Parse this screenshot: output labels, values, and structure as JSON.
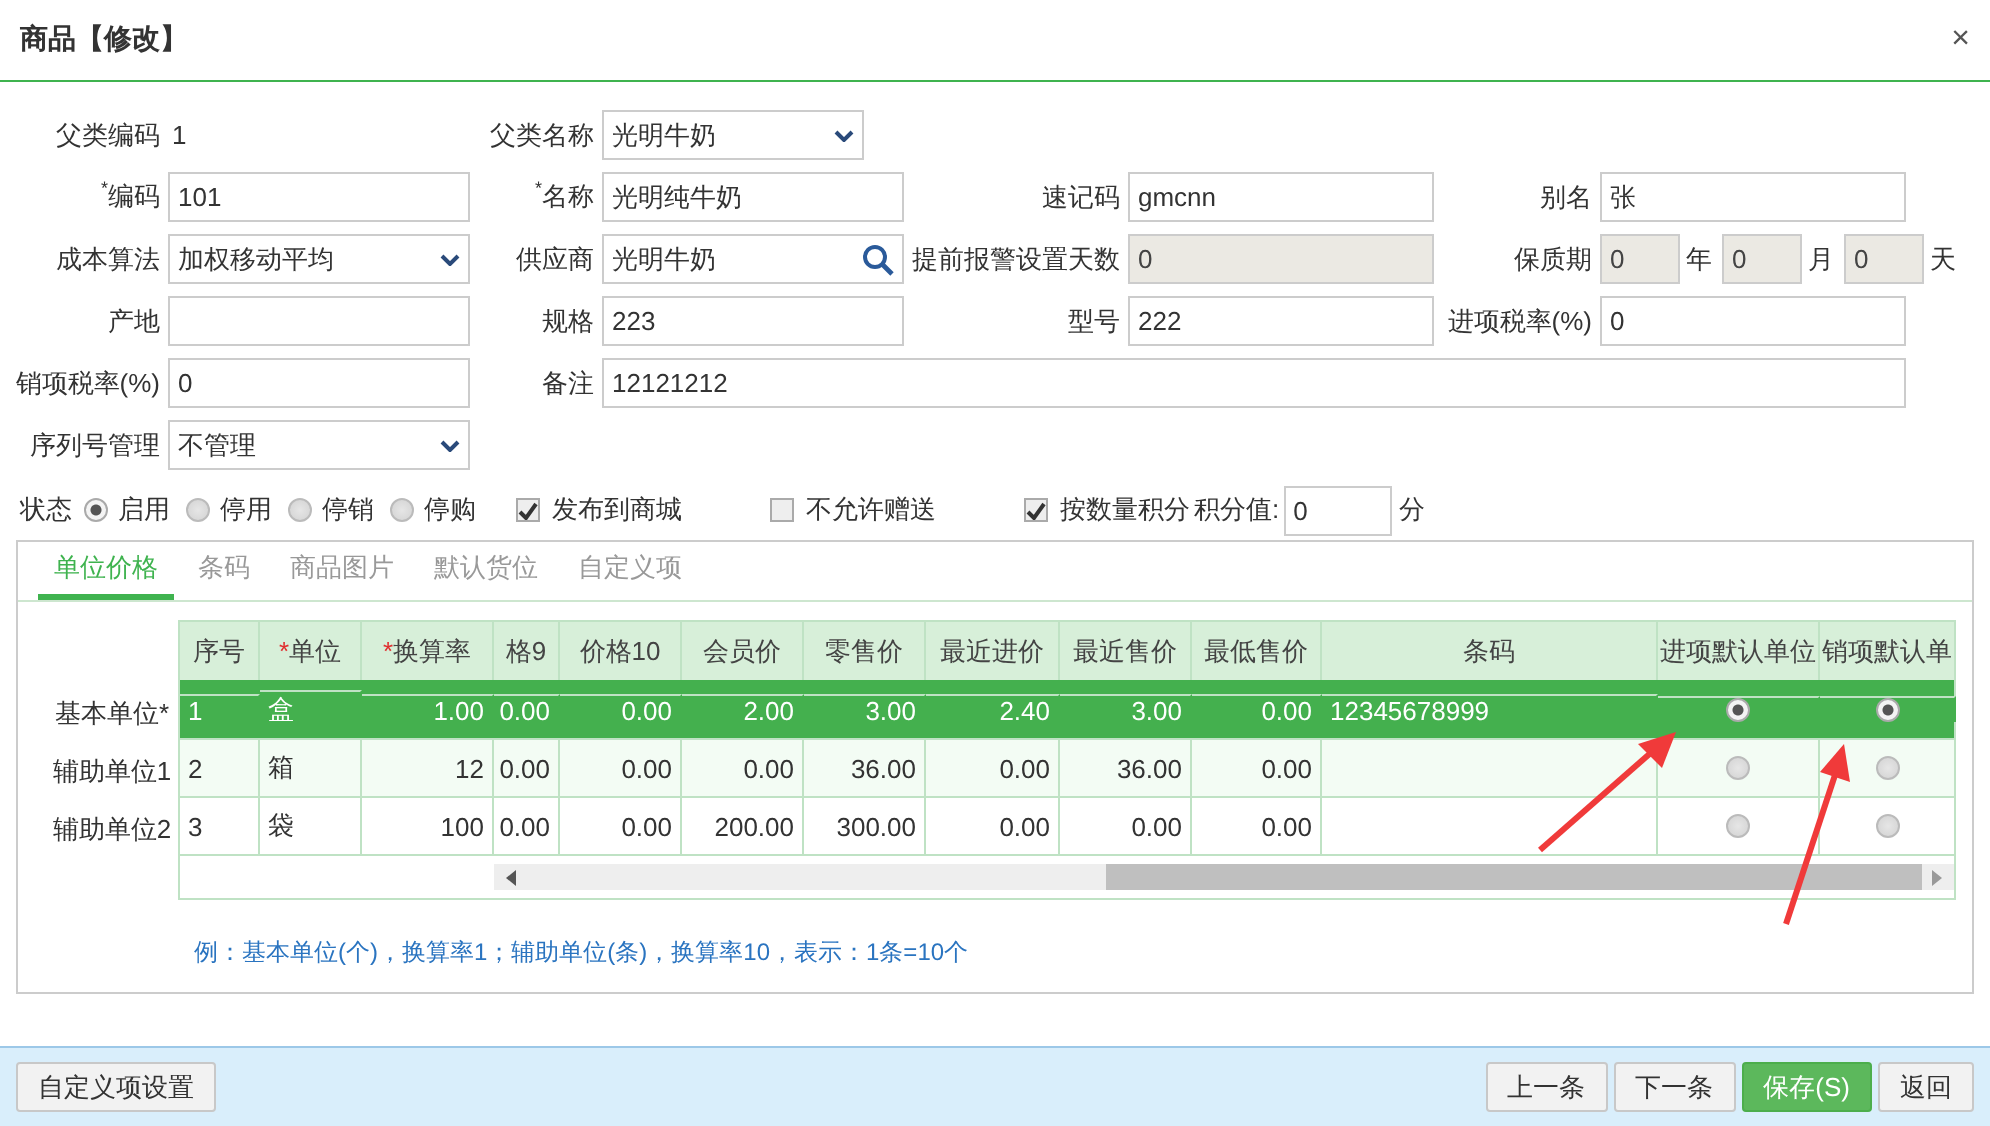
{
  "window": {
    "title": "商品【修改】",
    "close": "×"
  },
  "form": {
    "rows": [
      [
        {
          "label": "父类编码",
          "kind": "static",
          "value": "1"
        },
        {
          "label": "父类名称",
          "kind": "select",
          "value": "光明牛奶"
        }
      ],
      [
        {
          "label": "编码",
          "mark": "*",
          "kind": "text",
          "value": "101"
        },
        {
          "label": "名称",
          "mark": "*",
          "kind": "text",
          "value": "光明纯牛奶"
        },
        {
          "label": "速记码",
          "kind": "text",
          "value": "gmcnn"
        },
        {
          "label": "别名",
          "kind": "text",
          "value": "张"
        }
      ],
      [
        {
          "label": "成本算法",
          "kind": "select",
          "value": "加权移动平均"
        },
        {
          "label": "供应商",
          "kind": "search",
          "value": "光明牛奶"
        },
        {
          "label": "提前报警设置天数",
          "kind": "disabled",
          "value": "0"
        },
        {
          "label": "保质期",
          "kind": "period",
          "values": [
            "0",
            "0",
            "0"
          ],
          "units": [
            "年",
            "月",
            "天"
          ]
        }
      ],
      [
        {
          "label": "产地",
          "kind": "text"
        },
        {
          "label": "规格",
          "kind": "text",
          "value": "223"
        },
        {
          "label": "型号",
          "kind": "text",
          "value": "222"
        },
        {
          "label": "进项税率(%)",
          "kind": "text",
          "value": "0"
        }
      ],
      [
        {
          "label": "销项税率(%)",
          "kind": "text",
          "value": "0"
        },
        {
          "label": "备注",
          "kind": "wide",
          "value": "12121212"
        }
      ],
      [
        {
          "label": "序列号管理",
          "kind": "select",
          "value": "不管理"
        }
      ]
    ]
  },
  "status": {
    "label": "状态",
    "options": [
      {
        "label": "启用",
        "selected": true
      },
      {
        "label": "停用",
        "selected": false
      },
      {
        "label": "停销",
        "selected": false
      },
      {
        "label": "停购",
        "selected": false
      }
    ]
  },
  "checks": [
    {
      "label": "发布到商城",
      "checked": true
    },
    {
      "label": "不允许赠送",
      "checked": false
    },
    {
      "label": "按数量积分",
      "checked": true
    }
  ],
  "points": {
    "label": "积分值:",
    "value": "0",
    "unit": "分"
  },
  "tabs": [
    {
      "label": "单位价格",
      "selected": true
    },
    {
      "label": "条码",
      "selected": false
    },
    {
      "label": "商品图片",
      "selected": false
    },
    {
      "label": "默认货位",
      "selected": false
    },
    {
      "label": "自定义项",
      "selected": false
    }
  ],
  "table": {
    "row_labels": [
      "基本单位*",
      "辅助单位1",
      "辅助单位2"
    ],
    "columns": [
      {
        "label": "序号",
        "kind": "text"
      },
      {
        "label": "单位",
        "mark": "*",
        "kind": "text"
      },
      {
        "label": "换算率",
        "mark": "*",
        "kind": "number"
      },
      {
        "label": "格9",
        "kind": "number"
      },
      {
        "label": "价格10",
        "kind": "number"
      },
      {
        "label": "会员价",
        "kind": "number"
      },
      {
        "label": "零售价",
        "kind": "number"
      },
      {
        "label": "最近进价",
        "kind": "number"
      },
      {
        "label": "最近售价",
        "kind": "number"
      },
      {
        "label": "最低售价",
        "kind": "number"
      },
      {
        "label": "条码",
        "kind": "text"
      },
      {
        "label": "进项默认单位",
        "kind": "radio"
      },
      {
        "label": "销项默认单",
        "kind": "radio"
      }
    ],
    "rows": [
      {
        "selected": true,
        "cells": [
          "1",
          "盒",
          "1.00",
          "0.00",
          "0.00",
          "2.00",
          "3.00",
          "2.40",
          "3.00",
          "0.00",
          "12345678999"
        ],
        "defaults": [
          true,
          true
        ]
      },
      {
        "selected": false,
        "cells": [
          "2",
          "箱",
          "12",
          "0.00",
          "0.00",
          "0.00",
          "36.00",
          "0.00",
          "36.00",
          "0.00",
          ""
        ],
        "defaults": [
          false,
          false
        ]
      },
      {
        "selected": false,
        "cells": [
          "3",
          "袋",
          "100",
          "0.00",
          "0.00",
          "200.00",
          "300.00",
          "0.00",
          "0.00",
          "0.00",
          ""
        ],
        "defaults": [
          false,
          false
        ]
      }
    ]
  },
  "hint": "例：基本单位(个)，换算率1；辅助单位(条)，换算率10，表示：1条=10个",
  "footer": {
    "left": [
      {
        "label": "自定义项设置",
        "kind": "default"
      }
    ],
    "right": [
      {
        "label": "上一条",
        "kind": "default"
      },
      {
        "label": "下一条",
        "kind": "default"
      },
      {
        "label": "保存(S)",
        "kind": "primary"
      },
      {
        "label": "返回",
        "kind": "default"
      }
    ]
  }
}
